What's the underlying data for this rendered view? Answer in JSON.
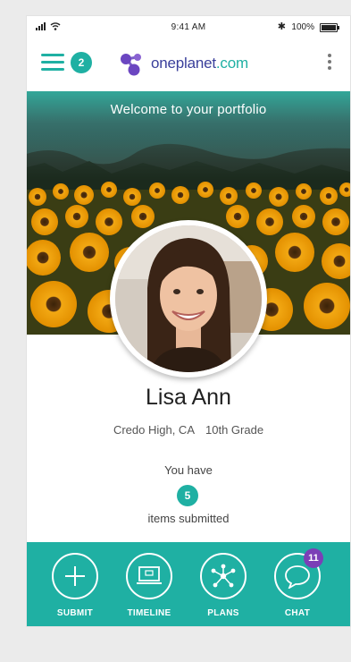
{
  "status_bar": {
    "time": "9:41 AM",
    "battery": "100%"
  },
  "header": {
    "menu_badge": "2",
    "brand_name": "oneplanet",
    "brand_tld": ".com",
    "accent_color": "#1fb0a3",
    "brand_color": "#3a3f9b"
  },
  "hero": {
    "title": "Welcome to your portfolio"
  },
  "profile": {
    "name": "Lisa Ann",
    "school": "Credo High, CA",
    "grade": "10th Grade",
    "summary_prefix": "You have",
    "items_count": "5",
    "summary_suffix": "items submitted"
  },
  "tabs": [
    {
      "label": "SUBMIT",
      "icon": "plus-icon"
    },
    {
      "label": "TIMELINE",
      "icon": "laptop-icon"
    },
    {
      "label": "PLANS",
      "icon": "network-icon"
    },
    {
      "label": "CHAT",
      "icon": "chat-bubble-icon",
      "badge": "11"
    }
  ]
}
